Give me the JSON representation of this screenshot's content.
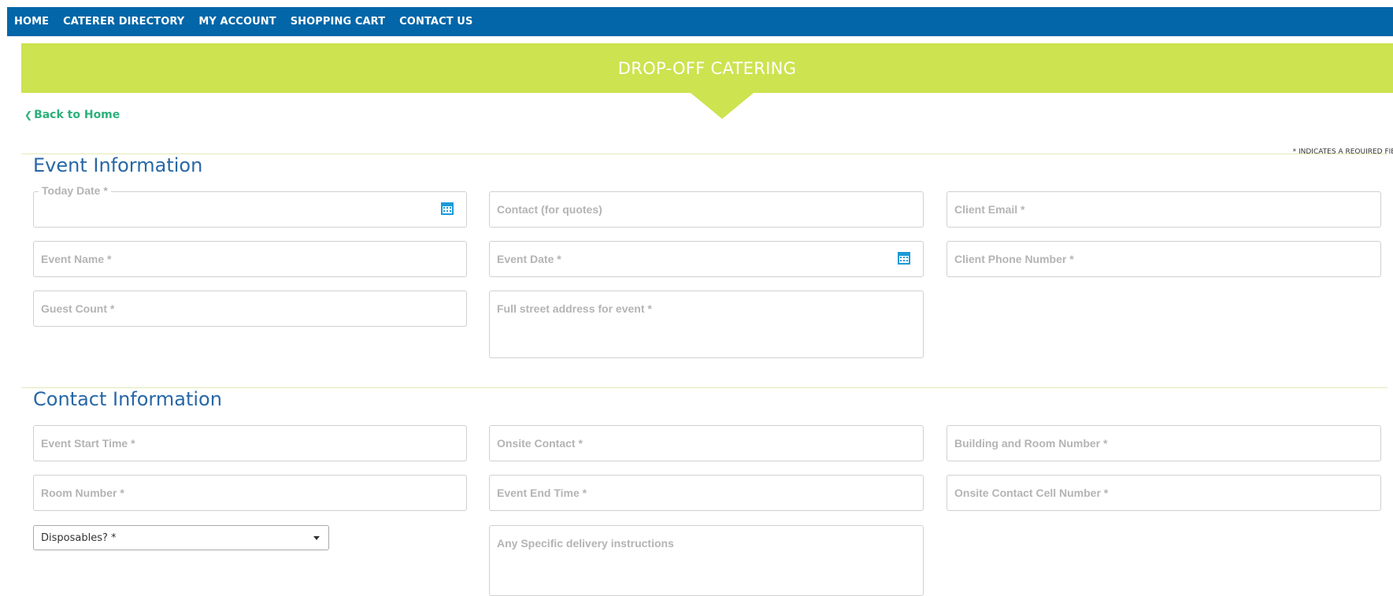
{
  "nav": {
    "home": "HOME",
    "caterer_directory": "CATERER DIRECTORY",
    "my_account": "MY ACCOUNT",
    "shopping_cart": "SHOPPING CART",
    "contact_us": "CONTACT US"
  },
  "banner": {
    "title": "DROP-OFF CATERING"
  },
  "back_link": {
    "chevron": "❮",
    "label": "Back to Home"
  },
  "required_note": "* INDICATES A REQUIRED FIEL",
  "event_info": {
    "title": "Event Information",
    "today_date_label": "Today Date *",
    "contact_quotes": "Contact (for quotes)",
    "client_email": "Client Email *",
    "event_name": "Event Name *",
    "event_date": "Event Date *",
    "client_phone": "Client Phone Number *",
    "guest_count": "Guest Count *",
    "street_address": "Full street address for event *"
  },
  "contact_info": {
    "title": "Contact Information",
    "event_start_time": "Event Start Time *",
    "onsite_contact": "Onsite Contact *",
    "building_room": "Building and Room Number *",
    "room_number": "Room Number *",
    "event_end_time": "Event End Time *",
    "onsite_cell": "Onsite Contact Cell Number *",
    "disposables": "Disposables? *",
    "delivery_instructions": "Any Specific delivery instructions"
  },
  "icons": {
    "calendar": "calendar-icon",
    "dropdown": "chevron-down-icon",
    "back": "chevron-left-icon"
  },
  "colors": {
    "nav_bg": "#0266a8",
    "banner_bg": "#cde350",
    "section_title": "#2767a6",
    "back_link": "#2bb07a",
    "calendar_icon": "#1a9ad6"
  }
}
